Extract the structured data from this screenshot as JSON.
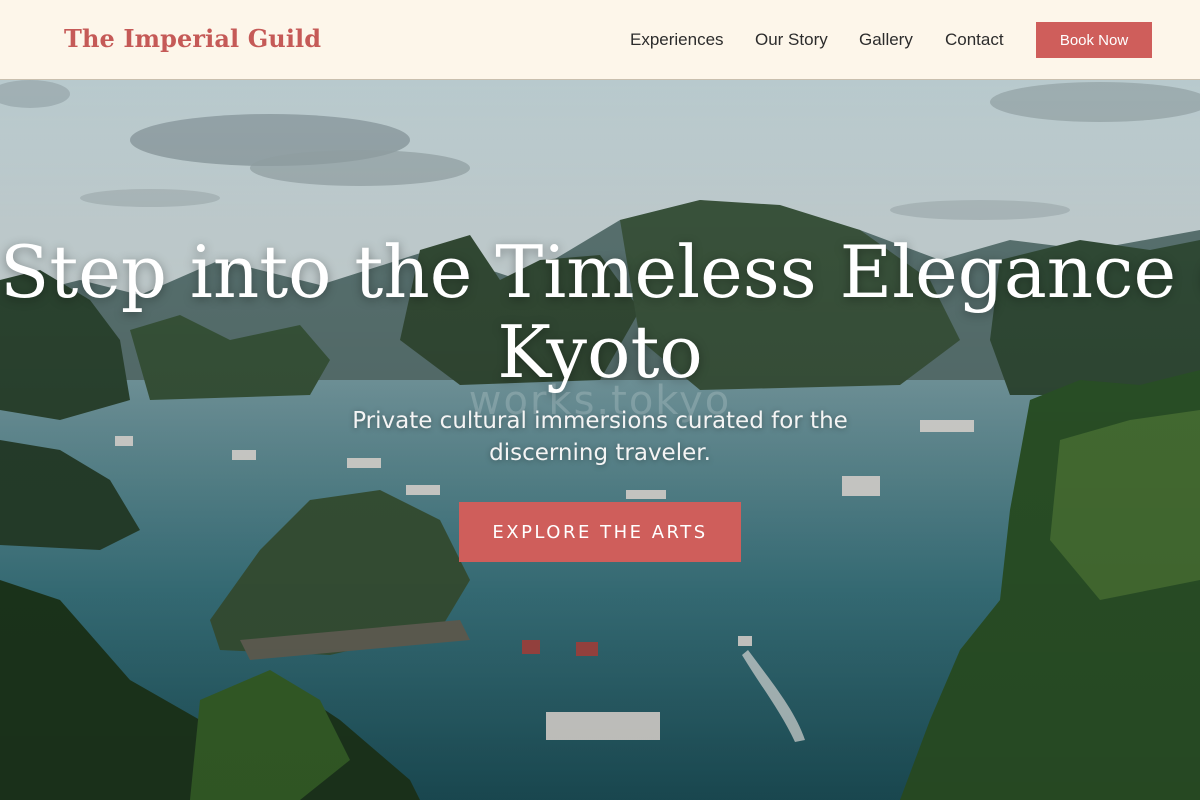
{
  "header": {
    "brand": "The Imperial Guild",
    "nav": {
      "experiences": "Experiences",
      "our_story": "Our Story",
      "gallery": "Gallery",
      "contact": "Contact"
    },
    "book_button": "Book Now"
  },
  "hero": {
    "title_line1": "Step into the Timeless Elegance of",
    "title_line2": "Kyoto",
    "watermark": "works.tokyo",
    "subtitle": "Private cultural immersions curated for the discerning traveler.",
    "cta": "EXPLORE THE ARTS"
  },
  "colors": {
    "accent": "#cf5e5b",
    "header_background": "#fdf6ea",
    "nav_text": "#2c2c2c"
  }
}
